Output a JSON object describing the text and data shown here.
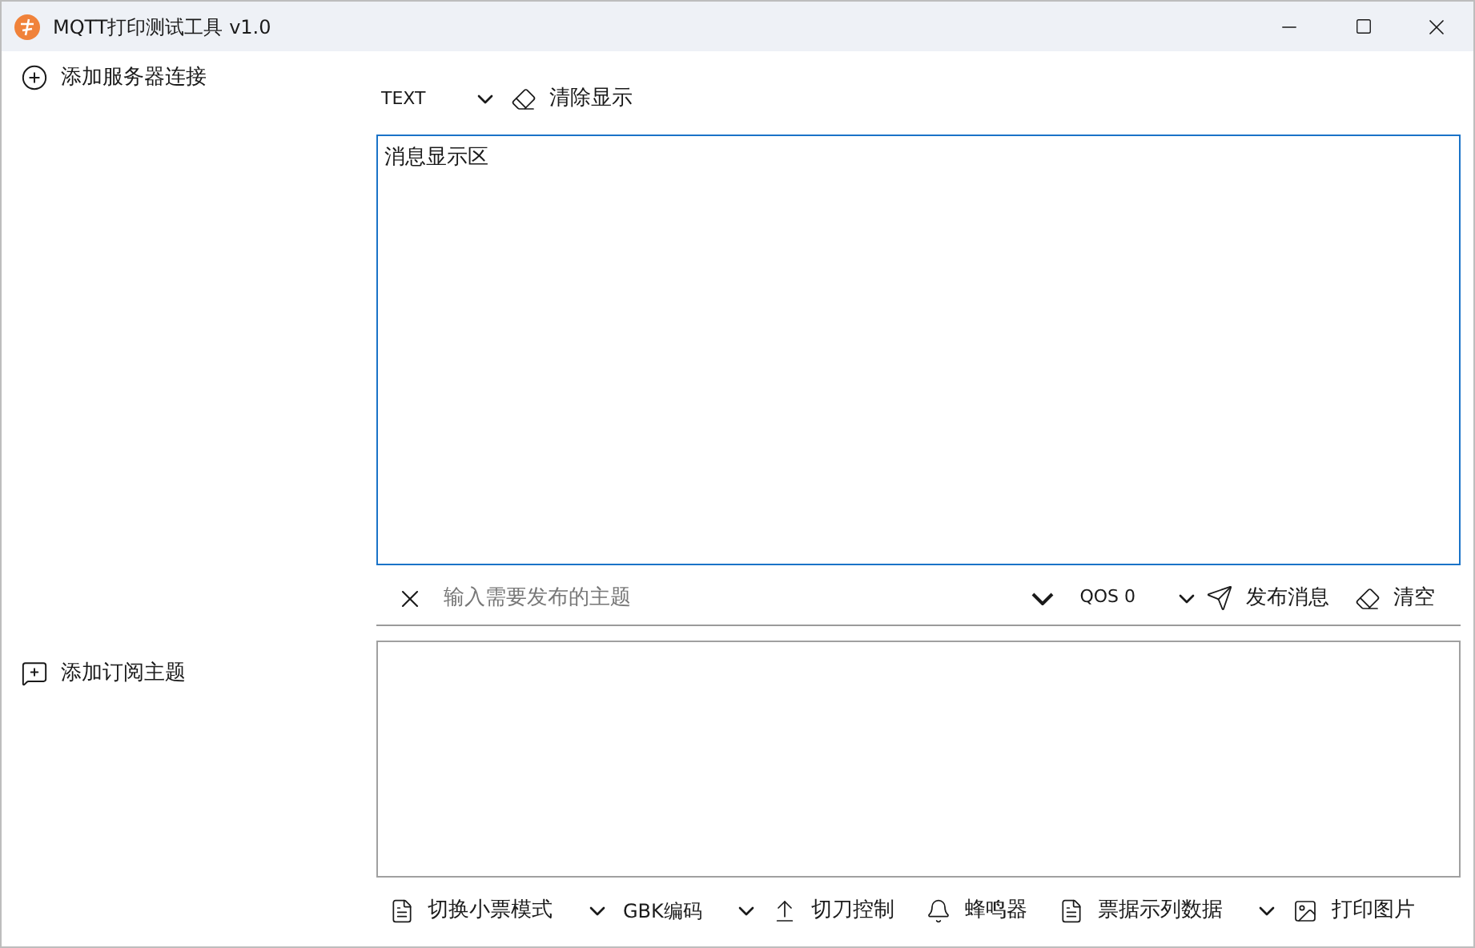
{
  "window": {
    "title": "MQTT打印测试工具 v1.0"
  },
  "sidebar": {
    "add_connection": "添加服务器连接",
    "add_subscription": "添加订阅主题"
  },
  "display_toolbar": {
    "format": "TEXT",
    "clear": "清除显示"
  },
  "message_display": {
    "text": "消息显示区"
  },
  "publish_bar": {
    "topic_placeholder": "输入需要发布的主题",
    "qos": "QOS 0",
    "publish": "发布消息",
    "clear": "清空"
  },
  "bottom_toolbar": [
    {
      "kind": "receipt",
      "label": "切换小票模式"
    },
    {
      "kind": "toggle"
    },
    {
      "kind": "text",
      "label": "GBK编码"
    },
    {
      "kind": "toggle"
    },
    {
      "kind": "cutter",
      "label": "切刀控制"
    },
    {
      "kind": "bell",
      "label": "蜂鸣器"
    },
    {
      "kind": "receipt",
      "label": "票据示列数据"
    },
    {
      "kind": "toggle"
    },
    {
      "kind": "image",
      "label": "打印图片"
    }
  ]
}
